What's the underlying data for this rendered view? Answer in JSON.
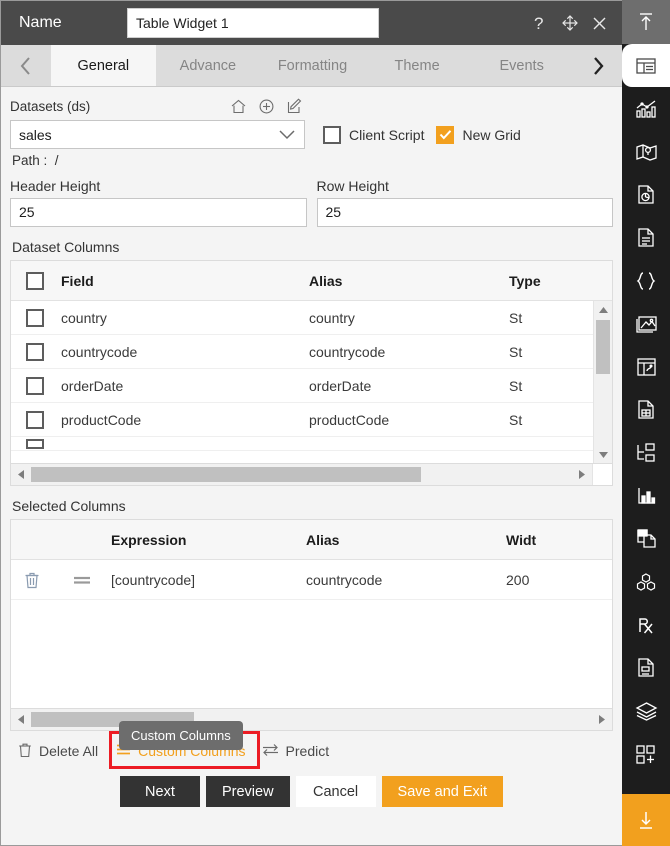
{
  "titlebar": {
    "name_label": "Name",
    "widget_name": "Table Widget 1",
    "help_icon": "question-mark-icon",
    "move_icon": "move-arrows-icon",
    "close_icon": "close-icon"
  },
  "tabs": {
    "prev_icon": "chevron-left-icon",
    "next_icon": "chevron-right-icon",
    "items": [
      {
        "label": "General",
        "active": true
      },
      {
        "label": "Advance",
        "active": false
      },
      {
        "label": "Formatting",
        "active": false
      },
      {
        "label": "Theme",
        "active": false
      },
      {
        "label": "Events",
        "active": false
      }
    ]
  },
  "datasets": {
    "label": "Datasets (ds)",
    "home_icon": "home-icon",
    "add_icon": "plus-circle-icon",
    "edit_icon": "edit-icon",
    "selected": "sales",
    "path_label": "Path :",
    "path_value": "/",
    "client_script": {
      "label": "Client Script",
      "checked": false
    },
    "new_grid": {
      "label": "New Grid",
      "checked": true
    }
  },
  "sizes": {
    "header_height_label": "Header Height",
    "header_height_value": "25",
    "row_height_label": "Row Height",
    "row_height_value": "25"
  },
  "dataset_columns": {
    "title": "Dataset Columns",
    "headers": {
      "field": "Field",
      "alias": "Alias",
      "type": "Type"
    },
    "rows": [
      {
        "field": "country",
        "alias": "country",
        "type": "St",
        "checked": false
      },
      {
        "field": "countrycode",
        "alias": "countrycode",
        "type": "St",
        "checked": false
      },
      {
        "field": "orderDate",
        "alias": "orderDate",
        "type": "St",
        "checked": false
      },
      {
        "field": "productCode",
        "alias": "productCode",
        "type": "St",
        "checked": false
      }
    ]
  },
  "selected_columns": {
    "title": "Selected Columns",
    "headers": {
      "expression": "Expression",
      "alias": "Alias",
      "width": "Widt"
    },
    "rows": [
      {
        "delete_icon": "trash-icon",
        "drag_icon": "drag-handle-icon",
        "expression": "[countrycode]",
        "alias": "countrycode",
        "width": "200"
      }
    ]
  },
  "tooltip": {
    "text": "Custom Columns"
  },
  "actions": {
    "delete_all": {
      "label": "Delete All",
      "icon": "trash-icon"
    },
    "custom_columns": {
      "label": "Custom Columns",
      "icon": "menu-lines-icon",
      "highlighted": true
    },
    "predict": {
      "label": "Predict",
      "icon": "swap-arrows-icon"
    }
  },
  "buttons": {
    "next": "Next",
    "preview": "Preview",
    "cancel": "Cancel",
    "save_and_exit": "Save and Exit"
  },
  "sidebar": {
    "top_icon": "collapse-up-icon",
    "items": [
      {
        "icon": "table-widget-icon",
        "selected": true
      },
      {
        "icon": "chart-icon",
        "selected": false
      },
      {
        "icon": "map-icon",
        "selected": false
      },
      {
        "icon": "pie-report-icon",
        "selected": false
      },
      {
        "icon": "document-icon",
        "selected": false
      },
      {
        "icon": "braces-icon",
        "selected": false
      },
      {
        "icon": "image-icon",
        "selected": false
      },
      {
        "icon": "dashboard-icon",
        "selected": false
      },
      {
        "icon": "spreadsheet-icon",
        "selected": false
      },
      {
        "icon": "tree-folder-icon",
        "selected": false
      },
      {
        "icon": "bar-chart-icon",
        "selected": false
      },
      {
        "icon": "copy-page-icon",
        "selected": false
      },
      {
        "icon": "cubes-icon",
        "selected": false
      },
      {
        "icon": "prescription-icon",
        "selected": false
      },
      {
        "icon": "script-document-icon",
        "selected": false
      },
      {
        "icon": "layers-icon",
        "selected": false
      },
      {
        "icon": "add-component-icon",
        "selected": false
      }
    ],
    "bottom_icon": "download-icon"
  },
  "colors": {
    "accent_orange": "#f2a01e",
    "highlight_red": "#ec1c24",
    "titlebar_dark": "#4a4a4a",
    "sidebar_dark": "#1d1d1d"
  }
}
